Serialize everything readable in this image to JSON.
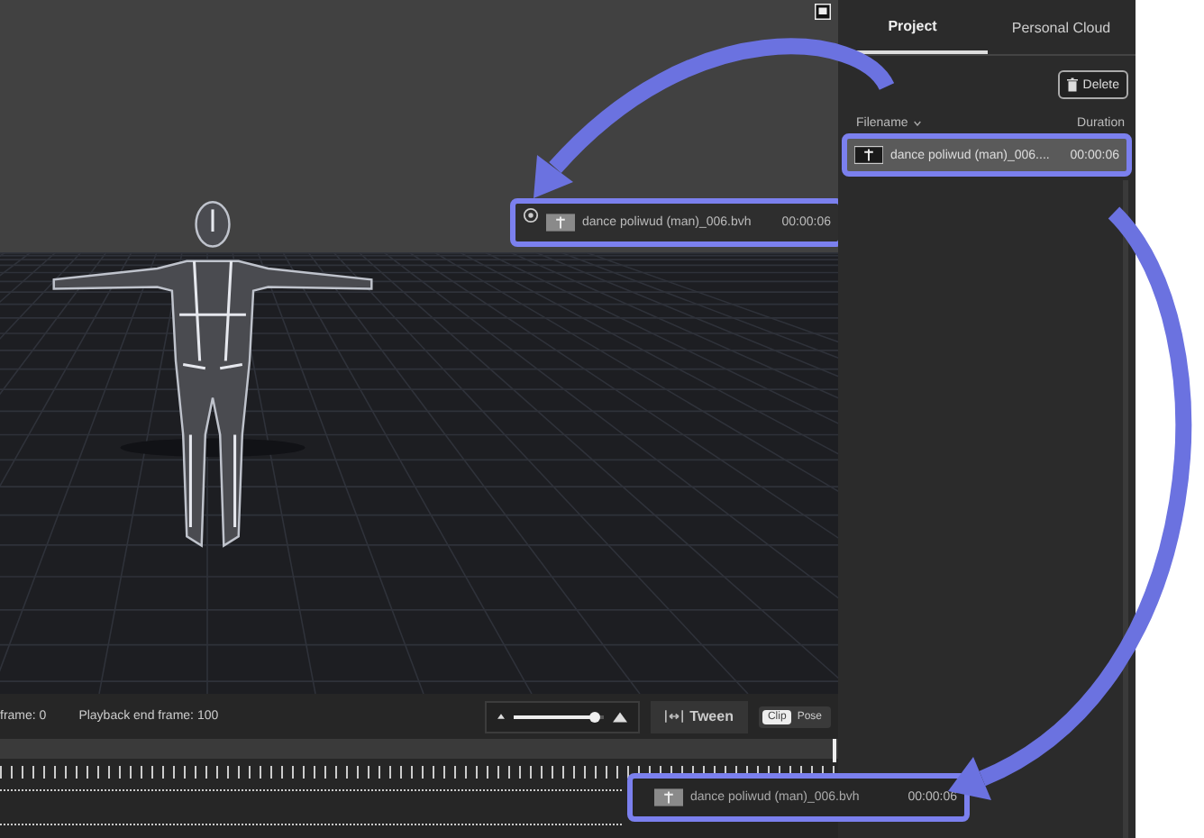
{
  "viewport": {
    "clip_card": {
      "filename": "dance poliwud (man)_006.bvh",
      "duration": "00:00:06"
    }
  },
  "panel": {
    "tabs": [
      {
        "label": "Project",
        "selected": true
      },
      {
        "label": "Personal Cloud",
        "selected": false
      }
    ],
    "delete_button": "Delete",
    "columns": [
      "Filename",
      "Duration"
    ],
    "files": [
      {
        "filename": "dance poliwud (man)_006....",
        "duration": "00:00:06",
        "selected": true
      }
    ]
  },
  "toolbar": {
    "start_frame": "frame:  0",
    "end_frame": "Playback end frame:  100",
    "zoom_slider": {
      "level": 0.9
    },
    "tween_button": "Tween",
    "modes": [
      {
        "label": "Clip",
        "selected": true
      },
      {
        "label": "Pose",
        "selected": false
      }
    ]
  },
  "timeline": {
    "clip": {
      "filename": "dance poliwud (man)_006.bvh",
      "duration": "00:00:06"
    }
  }
}
